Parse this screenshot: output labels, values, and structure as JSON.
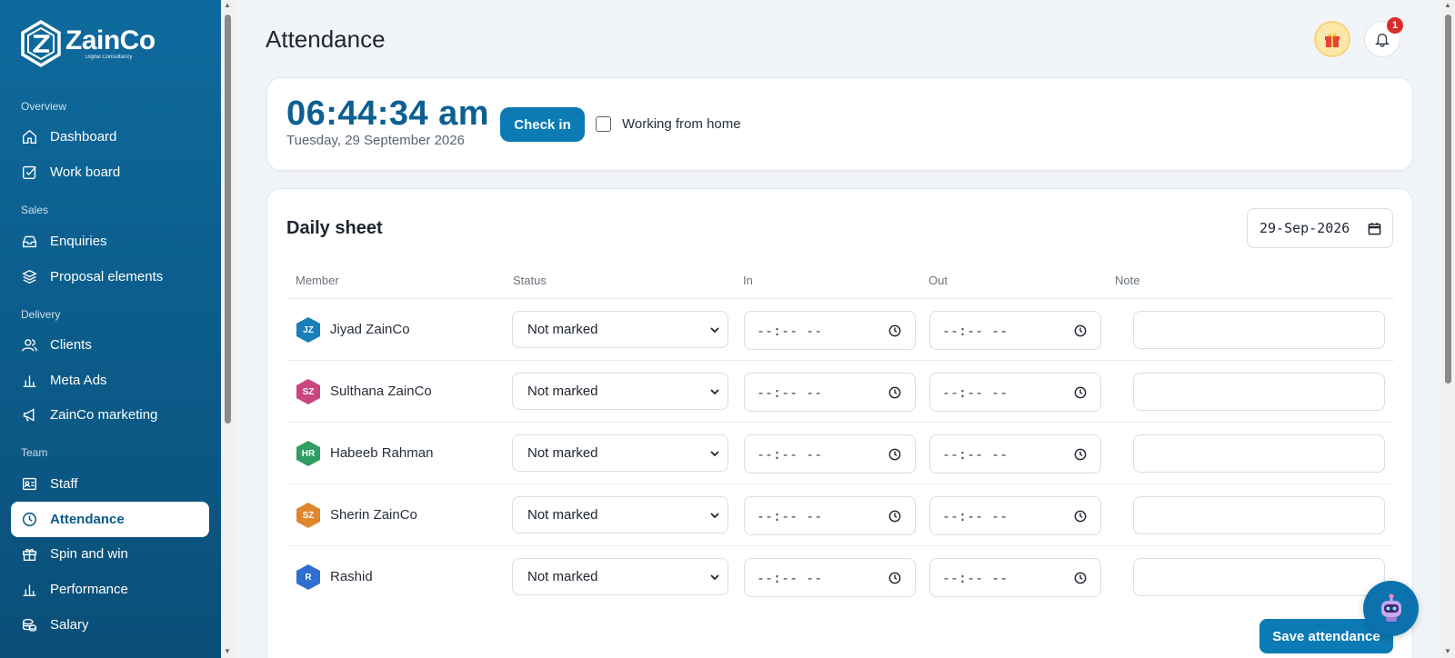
{
  "brand": {
    "name": "ZainCo",
    "tagline": "Digital Consultancy"
  },
  "sidebar": {
    "sections": [
      {
        "label": "Overview",
        "items": [
          {
            "label": "Dashboard",
            "icon": "home-icon"
          },
          {
            "label": "Work board",
            "icon": "checkbox-icon"
          }
        ]
      },
      {
        "label": "Sales",
        "items": [
          {
            "label": "Enquiries",
            "icon": "inbox-icon"
          },
          {
            "label": "Proposal elements",
            "icon": "layers-icon"
          }
        ]
      },
      {
        "label": "Delivery",
        "items": [
          {
            "label": "Clients",
            "icon": "users-icon"
          },
          {
            "label": "Meta Ads",
            "icon": "bar-chart-icon"
          },
          {
            "label": "ZainCo marketing",
            "icon": "megaphone-icon"
          }
        ]
      },
      {
        "label": "Team",
        "items": [
          {
            "label": "Staff",
            "icon": "id-card-icon"
          },
          {
            "label": "Attendance",
            "icon": "clock-icon",
            "active": true
          },
          {
            "label": "Spin and win",
            "icon": "gift-icon"
          },
          {
            "label": "Performance",
            "icon": "bar-chart-icon"
          },
          {
            "label": "Salary",
            "icon": "coins-icon"
          }
        ]
      }
    ]
  },
  "header": {
    "title": "Attendance",
    "notification_count": "1"
  },
  "clock": {
    "time": "06:44:34 am",
    "date": "Tuesday, 29 September 2026",
    "checkin_label": "Check in",
    "wfh_label": "Working from home",
    "wfh_checked": false
  },
  "sheet": {
    "title": "Daily sheet",
    "date_value": "29-Sep-2026",
    "columns": [
      "Member",
      "Status",
      "In",
      "Out",
      "Note"
    ],
    "rows": [
      {
        "initials": "JZ",
        "name": "Jiyad ZainCo",
        "color": "#1a7fb8",
        "status": "Not marked",
        "in": "--:-- --",
        "out": "--:-- --",
        "note": ""
      },
      {
        "initials": "SZ",
        "name": "Sulthana ZainCo",
        "color": "#c9457e",
        "status": "Not marked",
        "in": "--:-- --",
        "out": "--:-- --",
        "note": ""
      },
      {
        "initials": "HR",
        "name": "Habeeb Rahman",
        "color": "#2f9e62",
        "status": "Not marked",
        "in": "--:-- --",
        "out": "--:-- --",
        "note": ""
      },
      {
        "initials": "SZ",
        "name": "Sherin ZainCo",
        "color": "#e0862e",
        "status": "Not marked",
        "in": "--:-- --",
        "out": "--:-- --",
        "note": ""
      },
      {
        "initials": "R",
        "name": "Rashid",
        "color": "#2f6fd0",
        "status": "Not marked",
        "in": "--:-- --",
        "out": "--:-- --",
        "note": ""
      }
    ],
    "save_label": "Save attendance"
  },
  "colors": {
    "primary": "#0c7ab5",
    "sidebar": "#0a5b8a",
    "clock_text": "#0d5f92"
  }
}
